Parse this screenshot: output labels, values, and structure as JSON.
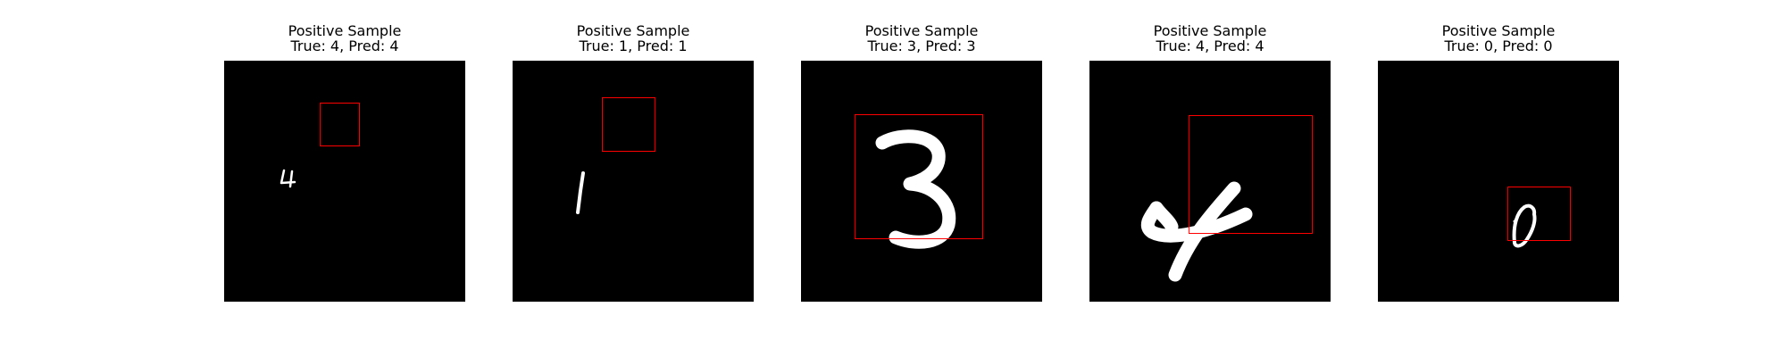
{
  "panels": [
    {
      "heading": "Positive Sample",
      "subheading": "True: 4, Pred: 4",
      "digit": "4"
    },
    {
      "heading": "Positive Sample",
      "subheading": "True: 1, Pred: 1",
      "digit": "1"
    },
    {
      "heading": "Positive Sample",
      "subheading": "True: 3, Pred: 3",
      "digit": "3"
    },
    {
      "heading": "Positive Sample",
      "subheading": "True: 4, Pred: 4",
      "digit": "4"
    },
    {
      "heading": "Positive Sample",
      "subheading": "True: 0, Pred: 0",
      "digit": "0"
    }
  ],
  "colors": {
    "box": "#ff0000",
    "background": "#000000",
    "digit": "#ffffff"
  }
}
